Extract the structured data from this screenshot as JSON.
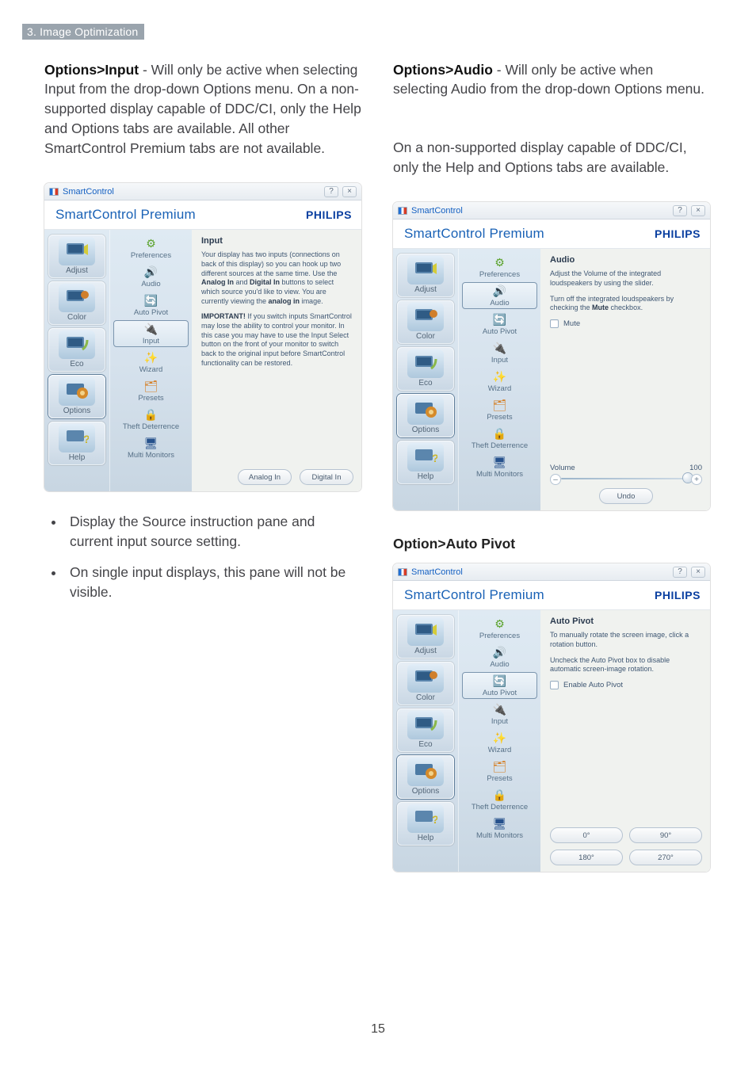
{
  "page": {
    "section_tag": "3. Image Optimization",
    "number": "15"
  },
  "left_col": {
    "intro_lead": "Options>Input",
    "intro_body": " - Will only be active when selecting Input from the drop-down Options menu. On a non-supported display capable of DDC/CI, only the Help and Options tabs are available. All other SmartControl Premium tabs are not available.",
    "bullet1": "Display the Source instruction pane and current input source setting.",
    "bullet2": "On single input displays, this pane will not be visible."
  },
  "right_col": {
    "intro_lead": "Options>Audio",
    "intro_body": " - Will only be active when selecting Audio from the drop-down Options menu.",
    "intro_body2": "On a non-supported display capable of DDC/CI, only the Help and Options tabs are available.",
    "pivot_heading": "Option>Auto Pivot"
  },
  "app_common": {
    "titlebar_label": "SmartControl",
    "product_name": "SmartControl Premium",
    "brand_name": "PHILIPS",
    "main_tabs": {
      "adjust": "Adjust",
      "color": "Color",
      "eco": "Eco",
      "options": "Options",
      "help": "Help"
    },
    "sub_tabs": {
      "preferences": "Preferences",
      "audio": "Audio",
      "auto_pivot": "Auto Pivot",
      "input": "Input",
      "wizard": "Wizard",
      "presets": "Presets",
      "theft": "Theft Deterrence",
      "multi": "Multi Monitors"
    }
  },
  "panel_input": {
    "title": "Input",
    "para1_a": "Your display has two inputs (connections on back of this display) so you can hook up two different sources at the same time. Use the ",
    "para1_b1": "Analog In",
    "para1_c": " and ",
    "para1_b2": "Digital In",
    "para1_d": " buttons to select which source you'd like to view. You are currently viewing the ",
    "para1_b3": "analog in",
    "para1_e": " image.",
    "para2_lead": "IMPORTANT!",
    "para2_body": " If you switch inputs SmartControl may lose the ability to control your monitor. In this case you may have to use the Input Select button on the front of your monitor to switch back to the original input before SmartControl functionality can be restored.",
    "btn_analog": "Analog In",
    "btn_digital": "Digital In"
  },
  "panel_audio": {
    "title": "Audio",
    "para1": "Adjust the Volume of the integrated loudspeakers by using the slider.",
    "para2_a": "Turn off the integrated loudspeakers by checking the ",
    "para2_b": "Mute",
    "para2_c": " checkbox.",
    "mute_label": "Mute",
    "volume_label": "Volume",
    "volume_value": "100",
    "btn_undo": "Undo"
  },
  "panel_pivot": {
    "title": "Auto Pivot",
    "para1": "To manually rotate the screen image, click a rotation button.",
    "para2": "Uncheck the Auto Pivot box to disable automatic screen-image rotation.",
    "enable_label": "Enable Auto Pivot",
    "btn0": "0°",
    "btn90": "90°",
    "btn180": "180°",
    "btn270": "270°"
  }
}
